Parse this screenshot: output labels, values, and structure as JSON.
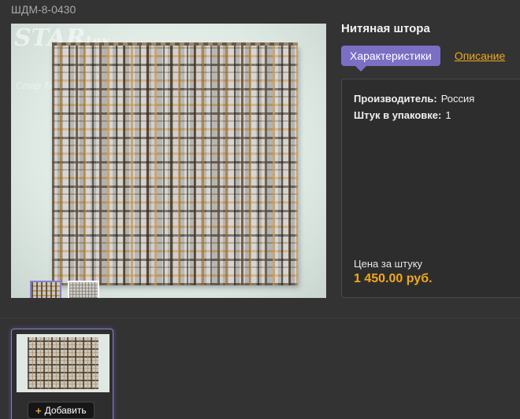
{
  "product": {
    "sku": "ШДМ-8-0430",
    "title": "Нитяная штора"
  },
  "logo": {
    "star": "STAR",
    "word": "tex",
    "sub": "Стар Те"
  },
  "tabs": [
    {
      "label": "Характеристики",
      "active": true
    },
    {
      "label": "Описание",
      "active": false
    }
  ],
  "specs": [
    {
      "key": "Производитель:",
      "value": "Россия"
    },
    {
      "key": "Штук в упаковке:",
      "value": "1"
    }
  ],
  "price": {
    "label": "Цена за штуку",
    "value": "1 450.00 руб."
  },
  "card": {
    "add_label": "Добавить"
  },
  "colors": {
    "accent": "#7b6fc4",
    "price": "#f0a81e",
    "background": "#333333"
  }
}
